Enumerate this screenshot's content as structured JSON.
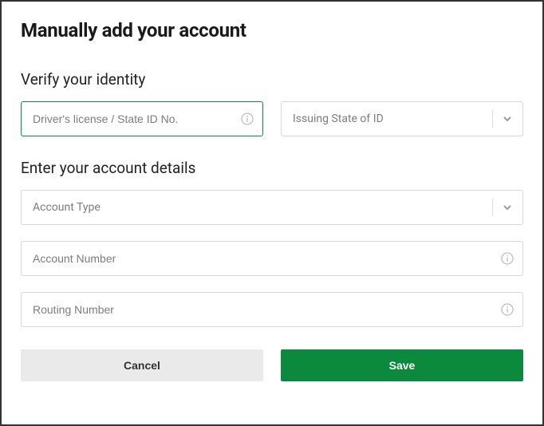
{
  "title": "Manually add your account",
  "sections": {
    "identity": {
      "heading": "Verify your identity",
      "license_placeholder": "Driver's license / State ID No.",
      "state_placeholder": "Issuing State of ID"
    },
    "account": {
      "heading": "Enter your account details",
      "type_placeholder": "Account Type",
      "number_placeholder": "Account Number",
      "routing_placeholder": "Routing Number"
    }
  },
  "buttons": {
    "cancel": "Cancel",
    "save": "Save"
  }
}
